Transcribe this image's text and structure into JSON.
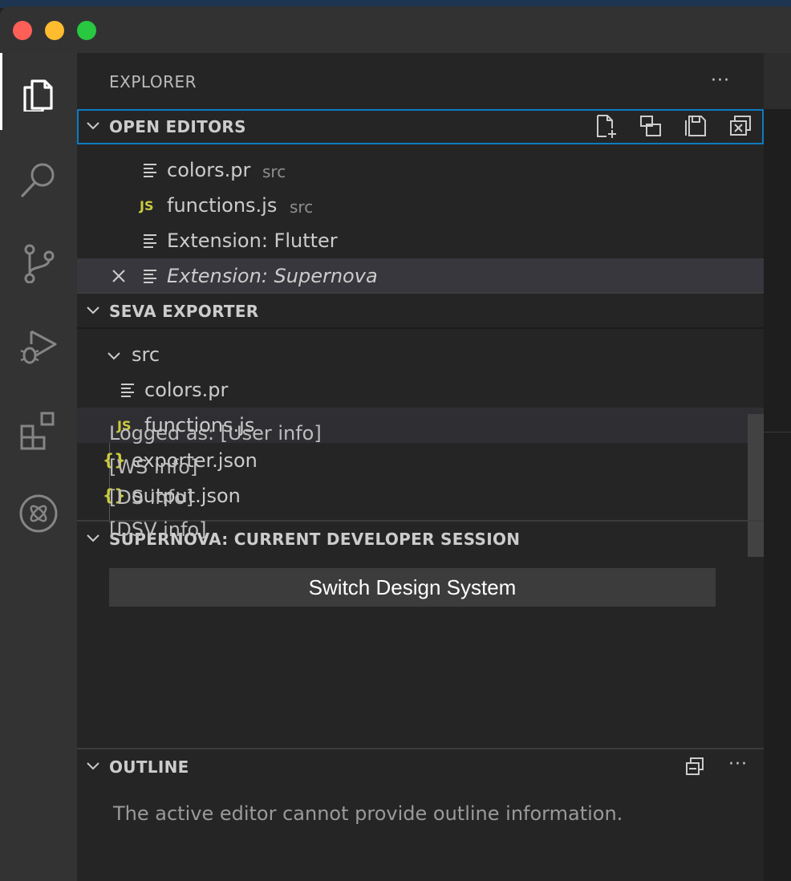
{
  "explorer": {
    "title": "EXPLORER",
    "more": "···"
  },
  "open_editors": {
    "title": "OPEN EDITORS",
    "toolbar_icons": [
      "new-file-icon",
      "split-editor-icon",
      "save-all-icon",
      "close-all-icon"
    ],
    "items": [
      {
        "name": "colors.pr",
        "desc": "src",
        "icon": "file-lines-icon"
      },
      {
        "name": "functions.js",
        "desc": "src",
        "icon": "js-icon",
        "icon_text": "JS"
      },
      {
        "name": "Extension: Flutter",
        "desc": "",
        "icon": "file-lines-icon"
      },
      {
        "name": "Extension: Supernova",
        "desc": "",
        "icon": "file-lines-icon",
        "preview": true,
        "selected": true
      }
    ]
  },
  "workspace": {
    "title": "SEVA EXPORTER",
    "folder": "src",
    "files": [
      {
        "name": "colors.pr",
        "icon": "file-lines-icon"
      },
      {
        "name": "functions.js",
        "icon": "js-icon",
        "icon_text": "JS"
      },
      {
        "name": "exporter.json",
        "icon": "json-icon",
        "icon_text": "{}"
      },
      {
        "name": "output.json",
        "icon": "json-icon",
        "icon_text": "{}"
      }
    ]
  },
  "session": {
    "title": "SUPERNOVA: CURRENT DEVELOPER SESSION",
    "logged_as": "Logged as: [User info]",
    "ws": "[WS info]",
    "ds": "[DS info]",
    "dsv": "[DSV info]",
    "switch_label": "Switch Design System"
  },
  "outline": {
    "title": "OUTLINE",
    "more": "···",
    "message": "The active editor cannot provide outline information."
  },
  "activity_bar": [
    "files-icon",
    "search-icon",
    "source-control-icon",
    "run-debug-icon",
    "extensions-icon",
    "supernova-icon"
  ],
  "colors": {
    "sidebar_bg": "#252526",
    "activity_bg": "#333333",
    "focus_border": "#0e7bc1",
    "json_js_yellow": "#cbcb41",
    "selected_row": "#37373d"
  }
}
